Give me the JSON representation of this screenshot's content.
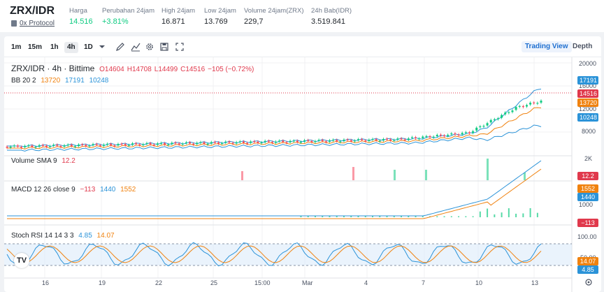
{
  "pair": {
    "title": "ZRX/IDR",
    "protocol_link": "0x Protocol"
  },
  "stats": [
    {
      "label": "Harga",
      "value": "14.516",
      "tone": "normal"
    },
    {
      "label": "Perubahan 24jam",
      "value": "+3.81%",
      "tone": "up"
    },
    {
      "label": "High 24jam",
      "value": "16.871",
      "tone": "normal"
    },
    {
      "label": "Low 24jam",
      "value": "13.769",
      "tone": "normal"
    },
    {
      "label": "Volume 24jam(ZRX)",
      "value": "229,7",
      "tone": "normal"
    },
    {
      "label": "24h Bab(IDR)",
      "value": "3.519.841",
      "tone": "normal"
    }
  ],
  "toolbar": {
    "timeframes": [
      "1m",
      "15m",
      "1h",
      "4h",
      "1D"
    ],
    "active_timeframe": "4h",
    "views": [
      "Trading View",
      "Depth"
    ],
    "active_view": "Trading View"
  },
  "main_chart": {
    "symbol_line": "ZRX/IDR · 4h · Bittime",
    "ohlc": {
      "o": "O14604",
      "h": "H14708",
      "l": "L14499",
      "c": "C14516",
      "chg": "−105 (−0.72%)"
    },
    "bb_label": "BB 20 2",
    "bb_values": [
      "13720",
      "17191",
      "10248"
    ],
    "y_ticks": [
      "20000",
      "16000",
      "12000",
      "8000"
    ],
    "price_boxes": [
      "17191",
      "14516",
      "13720",
      "10248"
    ]
  },
  "volume_panel": {
    "label": "Volume SMA 9",
    "value": "12.2",
    "y_ticks": [
      "2K"
    ],
    "price_box": "12.2"
  },
  "macd_panel": {
    "label": "MACD 12 26 close 9",
    "values": [
      "−113",
      "1440",
      "1552"
    ],
    "y_ticks": [
      "1000"
    ],
    "price_boxes": [
      "1552",
      "1440",
      "−113"
    ]
  },
  "stoch_panel": {
    "label": "Stoch RSI 14 14 3 3",
    "values": [
      "4.85",
      "14.07"
    ],
    "y_ticks": [
      "100.00",
      "50.00"
    ],
    "price_boxes": [
      "14.07",
      "4.85"
    ]
  },
  "x_axis": [
    "16",
    "19",
    "22",
    "25",
    "15:00",
    "Mar",
    "4",
    "7",
    "10",
    "13"
  ],
  "colors": {
    "up": "#0ecb81",
    "down": "#f6465d",
    "bb_band": "#2b93d8",
    "bb_basis": "#f0820f",
    "stoch_k": "#2b93d8",
    "stoch_d": "#f0820f",
    "accent": "#1e6fd0"
  },
  "icons": [
    "chevron-down-icon",
    "pencil-icon",
    "indicator-icon",
    "settings-icon",
    "save-icon",
    "fullscreen-icon",
    "tradingview-logo-icon",
    "reset-scale-icon"
  ]
}
